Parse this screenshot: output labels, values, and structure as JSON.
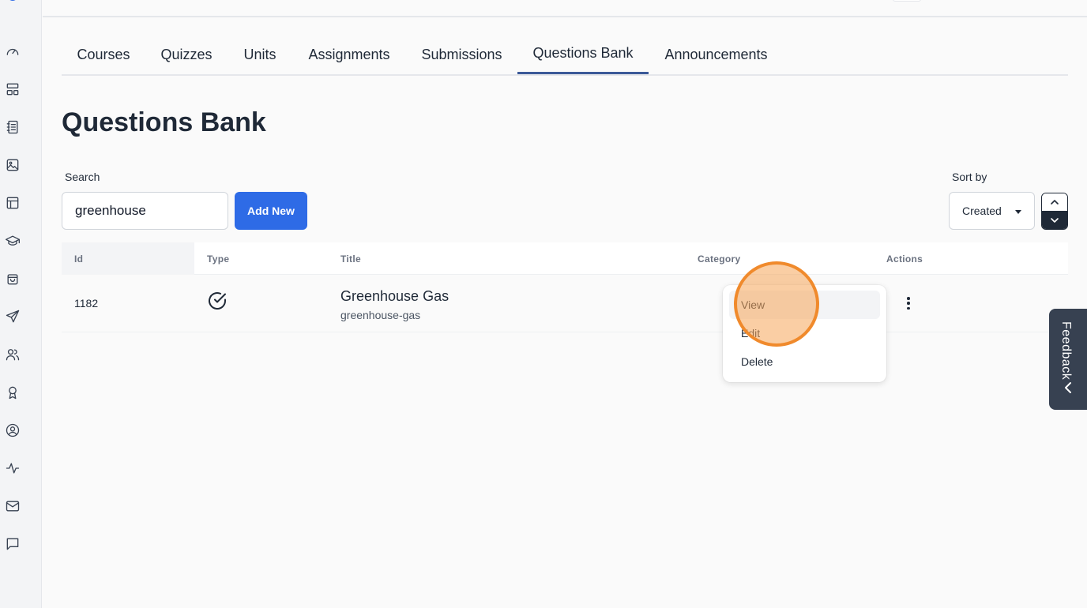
{
  "tabs": [
    {
      "label": "Courses",
      "active": false
    },
    {
      "label": "Quizzes",
      "active": false
    },
    {
      "label": "Units",
      "active": false
    },
    {
      "label": "Assignments",
      "active": false
    },
    {
      "label": "Submissions",
      "active": false
    },
    {
      "label": "Questions Bank",
      "active": true
    },
    {
      "label": "Announcements",
      "active": false
    }
  ],
  "page": {
    "title": "Questions Bank"
  },
  "search": {
    "label": "Search",
    "value": "greenhouse"
  },
  "toolbar": {
    "add_label": "Add New"
  },
  "sort": {
    "label": "Sort by",
    "selected": "Created",
    "direction": "desc"
  },
  "table": {
    "headers": {
      "id": "Id",
      "type": "Type",
      "title": "Title",
      "category": "Category",
      "actions": "Actions"
    },
    "rows": [
      {
        "id": "1182",
        "type_icon": "check-circle-icon",
        "title": "Greenhouse Gas",
        "slug": "greenhouse-gas",
        "category": ""
      }
    ]
  },
  "actions_menu": {
    "items": [
      "View",
      "Edit",
      "Delete"
    ],
    "highlighted": "View"
  },
  "feedback": {
    "label": "Feedback"
  },
  "sidebar": {
    "icons": [
      "dashboard-icon",
      "layout-icon",
      "notebook-icon",
      "image-icon",
      "table-icon",
      "graduation-cap-icon",
      "shopping-bag-icon",
      "send-icon",
      "users-icon",
      "award-icon",
      "user-circle-icon",
      "activity-icon",
      "mail-icon",
      "message-icon"
    ]
  },
  "colors": {
    "primary": "#2e6be6",
    "active_tab": "#3b5998",
    "highlight": "#f08a2c",
    "feedback_bg": "#374151"
  }
}
